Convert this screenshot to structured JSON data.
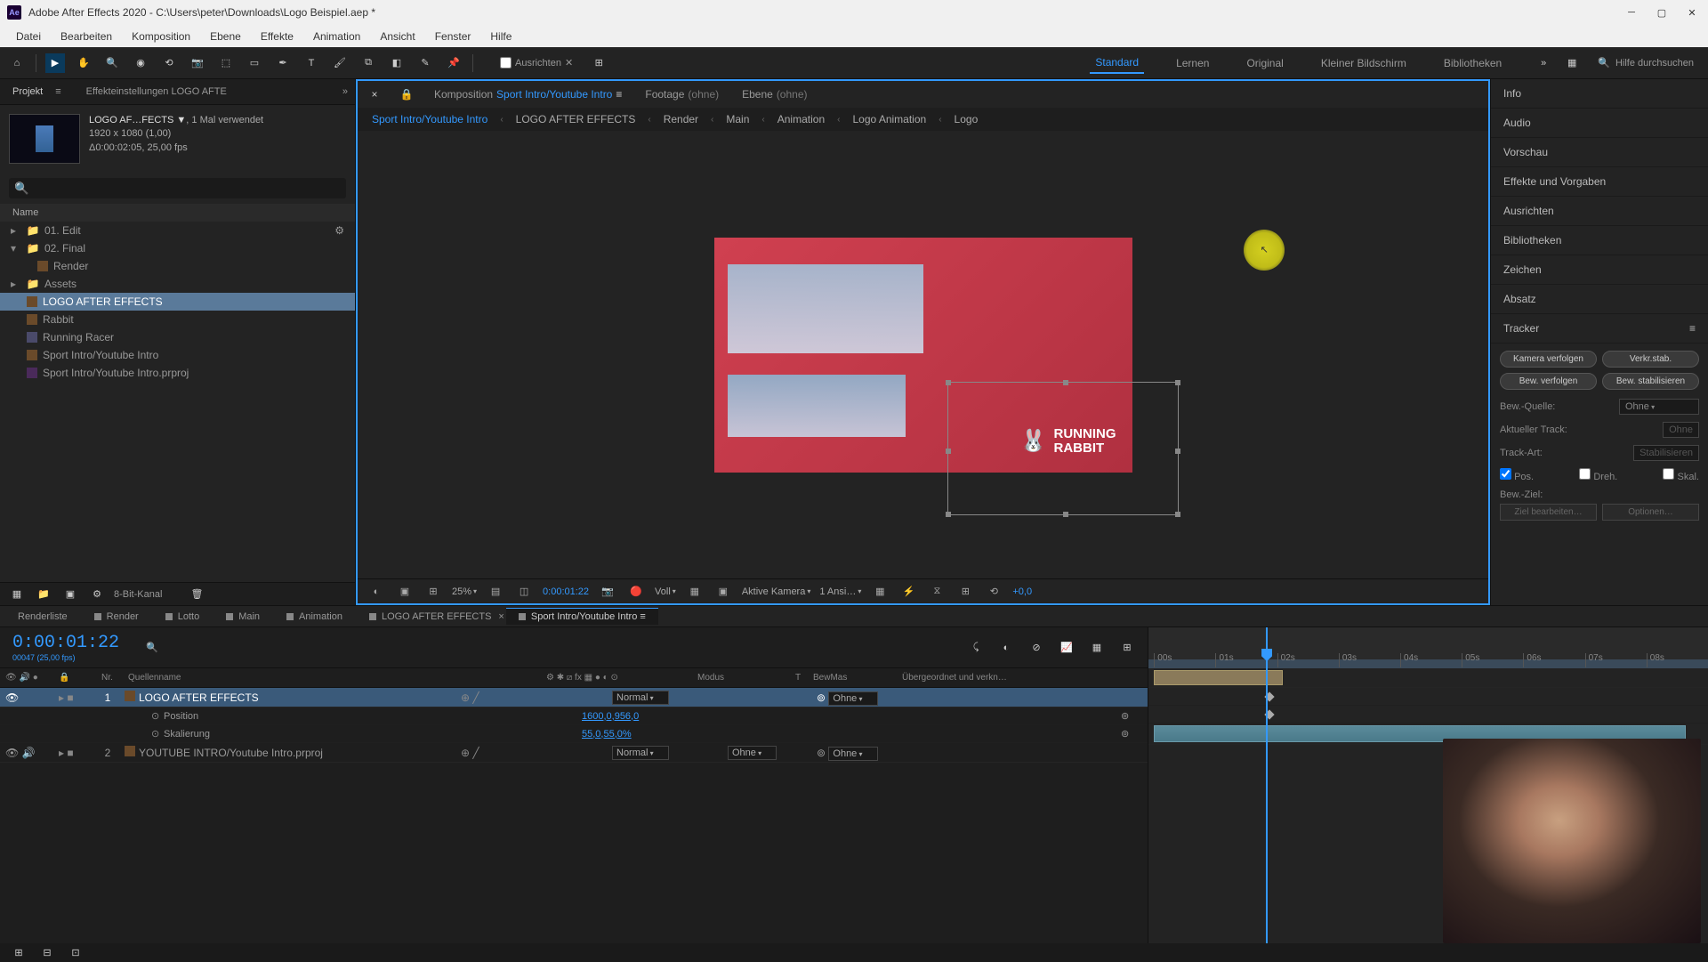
{
  "titlebar": {
    "app": "Ae",
    "title": "Adobe After Effects 2020 - C:\\Users\\peter\\Downloads\\Logo Beispiel.aep *"
  },
  "menubar": [
    "Datei",
    "Bearbeiten",
    "Komposition",
    "Ebene",
    "Effekte",
    "Animation",
    "Ansicht",
    "Fenster",
    "Hilfe"
  ],
  "toolbar": {
    "align_label": "Ausrichten",
    "workspaces": [
      "Standard",
      "Lernen",
      "Original",
      "Kleiner Bildschirm",
      "Bibliotheken"
    ],
    "active_workspace": "Standard",
    "search_placeholder": "Hilfe durchsuchen"
  },
  "project": {
    "tab_label": "Projekt",
    "settings_label": "Effekteinstellungen LOGO AFTE",
    "comp_name": "LOGO AF…FECTS ▼",
    "comp_usage": ", 1 Mal verwendet",
    "resolution": "1920 x 1080 (1,00)",
    "duration": "Δ0:00:02:05, 25,00 fps",
    "name_col": "Name",
    "items": [
      {
        "label": "01. Edit",
        "type": "folder",
        "level": 0,
        "expandable": true
      },
      {
        "label": "02. Final",
        "type": "folder",
        "level": 0,
        "expandable": true,
        "expanded": true
      },
      {
        "label": "Render",
        "type": "comp",
        "level": 1
      },
      {
        "label": "Assets",
        "type": "folder",
        "level": 0,
        "expandable": true
      },
      {
        "label": "LOGO AFTER EFFECTS",
        "type": "comp",
        "level": 0,
        "selected": true
      },
      {
        "label": "Rabbit",
        "type": "comp",
        "level": 0
      },
      {
        "label": "Running Racer",
        "type": "file",
        "level": 0
      },
      {
        "label": "Sport Intro/Youtube Intro",
        "type": "comp",
        "level": 0
      },
      {
        "label": "Sport Intro/Youtube Intro.prproj",
        "type": "proj",
        "level": 0
      }
    ],
    "footer_label": "8-Bit-Kanal"
  },
  "viewer": {
    "tabs": [
      {
        "prefix": "Komposition",
        "name": "Sport Intro/Youtube Intro",
        "active": true
      },
      {
        "prefix": "Footage",
        "name": "(ohne)"
      },
      {
        "prefix": "Ebene",
        "name": "(ohne)"
      }
    ],
    "breadcrumb": [
      "Sport Intro/Youtube Intro",
      "LOGO AFTER EFFECTS",
      "Render",
      "Main",
      "Animation",
      "Logo Animation",
      "Logo"
    ],
    "logo_text1": "RUNNING",
    "logo_text2": "RABBIT",
    "controls": {
      "zoom": "25%",
      "timecode": "0:00:01:22",
      "resolution": "Voll",
      "camera": "Aktive Kamera",
      "views": "1 Ansi…",
      "offset": "+0,0"
    }
  },
  "right_panels": [
    "Info",
    "Audio",
    "Vorschau",
    "Effekte und Vorgaben",
    "Ausrichten",
    "Bibliotheken",
    "Zeichen",
    "Absatz"
  ],
  "tracker": {
    "title": "Tracker",
    "btn_camera": "Kamera verfolgen",
    "btn_warp": "Verkr.stab.",
    "btn_track": "Bew. verfolgen",
    "btn_stabilize": "Bew. stabilisieren",
    "source_label": "Bew.-Quelle:",
    "source_value": "Ohne",
    "track_label": "Aktueller Track:",
    "track_value": "Ohne",
    "type_label": "Track-Art:",
    "type_value": "Stabilisieren",
    "pos": "Pos.",
    "rot": "Dreh.",
    "scale": "Skal.",
    "target_label": "Bew.-Ziel:",
    "edit_btn": "Ziel bearbeiten…",
    "options_btn": "Optionen…"
  },
  "timeline": {
    "tabs": [
      "Renderliste",
      "Render",
      "Lotto",
      "Main",
      "Animation",
      "LOGO AFTER EFFECTS",
      "Sport Intro/Youtube Intro"
    ],
    "active_tab": 6,
    "timecode": "0:00:01:22",
    "timecode_sub": "00047 (25,00 fps)",
    "col_nr": "Nr.",
    "col_name": "Quellenname",
    "col_mode": "Modus",
    "col_matte": "T",
    "col_matte2": "BewMas",
    "col_parent": "Übergeordnet und verkn…",
    "layers": [
      {
        "num": "1",
        "name": "LOGO AFTER EFFECTS",
        "mode": "Normal",
        "matte": "",
        "parent": "Ohne",
        "selected": true
      },
      {
        "num": "2",
        "name": "YOUTUBE INTRO/Youtube Intro.prproj",
        "mode": "Normal",
        "matte": "Ohne",
        "parent": "Ohne"
      }
    ],
    "props": [
      {
        "name": "Position",
        "value": "1600,0,956,0"
      },
      {
        "name": "Skalierung",
        "value": "55,0,55,0%"
      }
    ],
    "ruler": [
      "00s",
      "01s",
      "02s",
      "03s",
      "04s",
      "05s",
      "06s",
      "07s",
      "08s"
    ]
  }
}
